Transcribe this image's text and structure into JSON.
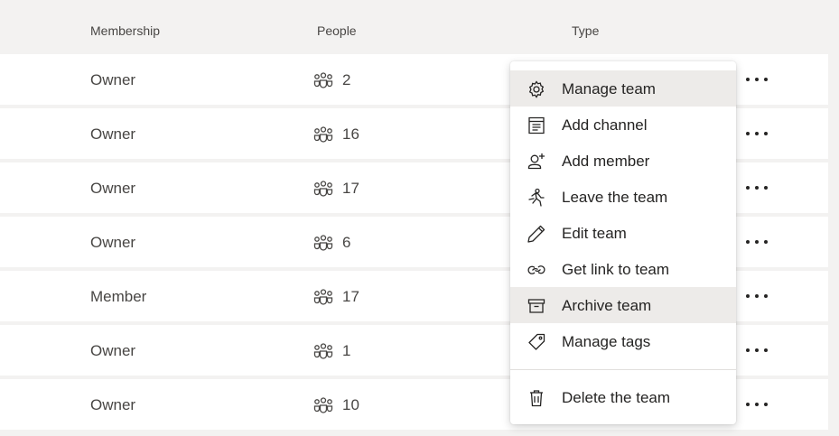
{
  "header": {
    "membership": "Membership",
    "people": "People",
    "type": "Type"
  },
  "rows": [
    {
      "membership": "Owner",
      "people": "2"
    },
    {
      "membership": "Owner",
      "people": "16"
    },
    {
      "membership": "Owner",
      "people": "17"
    },
    {
      "membership": "Owner",
      "people": "6"
    },
    {
      "membership": "Member",
      "people": "17"
    },
    {
      "membership": "Owner",
      "people": "1"
    },
    {
      "membership": "Owner",
      "people": "10"
    }
  ],
  "menu": {
    "items": [
      {
        "label": "Manage team",
        "icon": "gear-icon"
      },
      {
        "label": "Add channel",
        "icon": "channel-icon"
      },
      {
        "label": "Add member",
        "icon": "add-person-icon"
      },
      {
        "label": "Leave the team",
        "icon": "walking-person-icon"
      },
      {
        "label": "Edit team",
        "icon": "pencil-icon"
      },
      {
        "label": "Get link to team",
        "icon": "link-icon"
      },
      {
        "label": "Archive team",
        "icon": "archive-box-icon"
      },
      {
        "label": "Manage tags",
        "icon": "tag-icon"
      }
    ],
    "delete_label": "Delete the team",
    "delete_icon": "trash-icon",
    "hover_item": "Manage team",
    "selected_item": "Archive team"
  },
  "colors": {
    "background": "#f3f2f1",
    "row": "#ffffff",
    "highlight": "#edebe9",
    "text": "#252423"
  }
}
